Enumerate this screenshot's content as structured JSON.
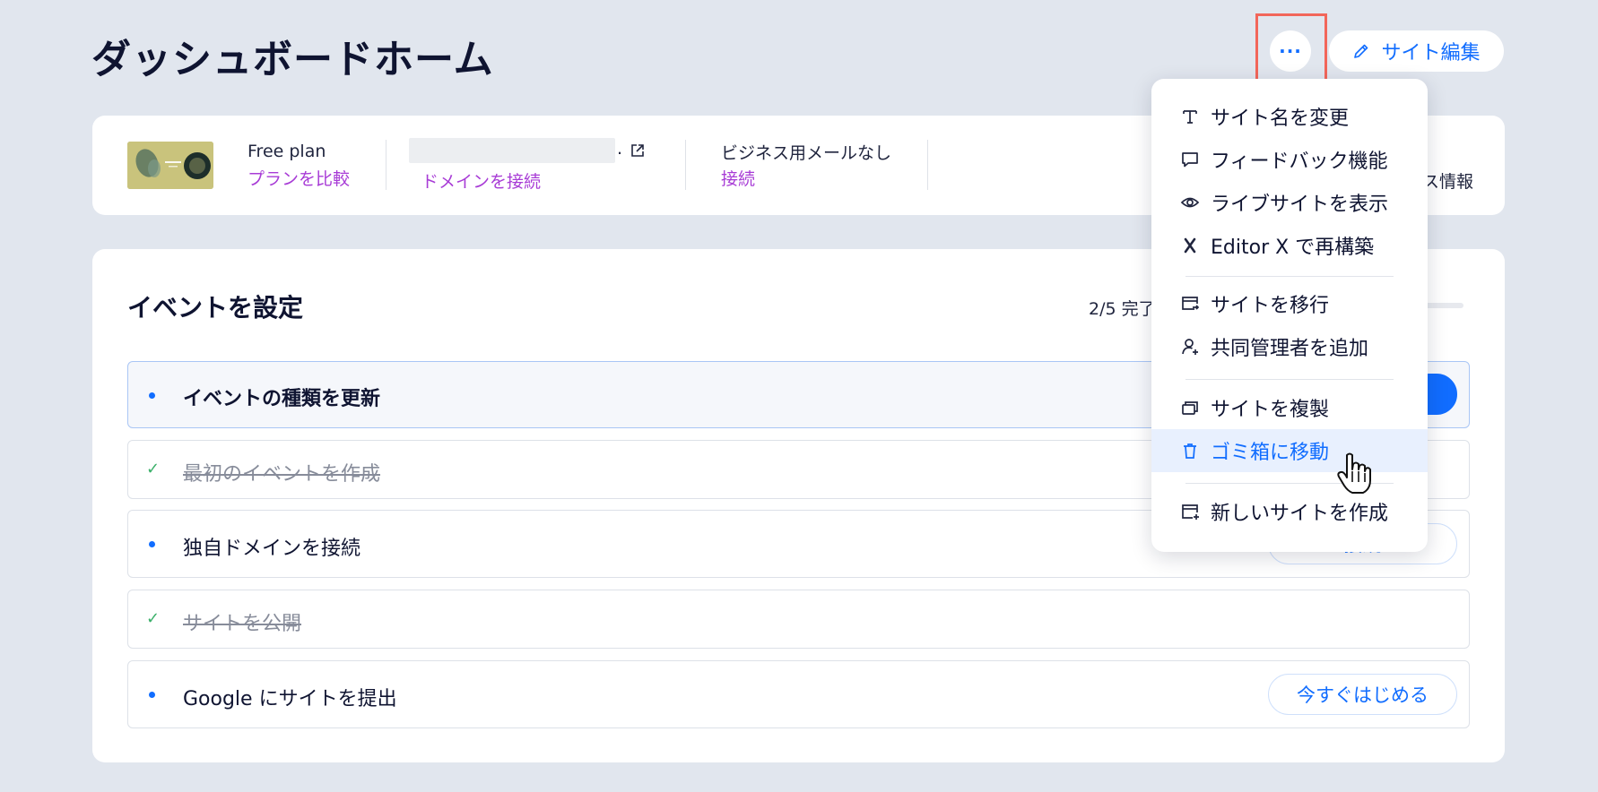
{
  "header": {
    "title": "ダッシュボードホーム",
    "more_label": "···",
    "edit_label": "サイト編集"
  },
  "info": {
    "plan_title": "Free plan",
    "plan_link": "プランを比較",
    "domain_suffix": ".",
    "domain_link": "ドメインを接続",
    "mail_title": "ビジネス用メールなし",
    "mail_link": "接続",
    "right_text": "ス情報"
  },
  "setup": {
    "title": "イベントを設定",
    "progress_text": "2/5 完了",
    "progress_fraction": 0.4,
    "tasks": [
      {
        "label": "イベントの種類を更新",
        "state": "active",
        "button": ""
      },
      {
        "label": "最初のイベントを作成",
        "state": "done",
        "button": ""
      },
      {
        "label": "独自ドメインを接続",
        "state": "todo",
        "button": "接続"
      },
      {
        "label": "サイトを公開",
        "state": "done",
        "button": ""
      },
      {
        "label": "Google にサイトを提出",
        "state": "todo",
        "button": "今すぐはじめる"
      }
    ]
  },
  "menu": {
    "items": [
      {
        "label": "サイト名を変更",
        "icon": "text-icon"
      },
      {
        "label": "フィードバック機能",
        "icon": "comment-icon"
      },
      {
        "label": "ライブサイトを表示",
        "icon": "eye-icon"
      },
      {
        "label": "Editor X で再構築",
        "icon": "editor-x-icon"
      },
      {
        "label": "サイトを移行",
        "icon": "transfer-site-icon"
      },
      {
        "label": "共同管理者を追加",
        "icon": "add-collaborator-icon"
      },
      {
        "label": "サイトを複製",
        "icon": "duplicate-icon"
      },
      {
        "label": "ゴミ箱に移動",
        "icon": "trash-icon"
      },
      {
        "label": "新しいサイトを作成",
        "icon": "new-site-icon"
      }
    ]
  },
  "colors": {
    "accent": "#116dff",
    "link_purple": "#a83cd6",
    "highlight": "#f2665a",
    "background": "#e1e6ee"
  }
}
